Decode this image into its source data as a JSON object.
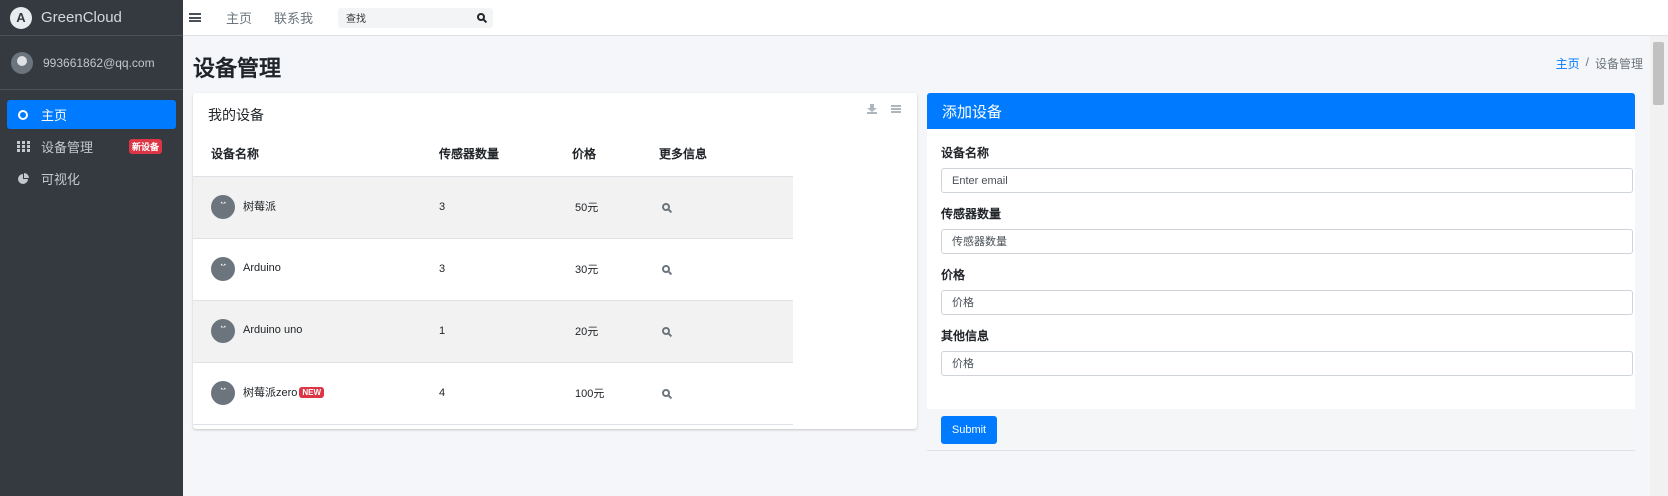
{
  "brand": {
    "name": "GreenCloud",
    "logo_letter": "A"
  },
  "user": {
    "email": "993661862@qq.com"
  },
  "sidebar": {
    "items": [
      {
        "label": "主页",
        "icon": "circle-icon",
        "active": true
      },
      {
        "label": "设备管理",
        "icon": "grid-icon",
        "badge": "新设备"
      },
      {
        "label": "可视化",
        "icon": "pie-chart-icon"
      }
    ]
  },
  "topbar": {
    "links": [
      "主页",
      "联系我"
    ],
    "search": {
      "value": "查找"
    }
  },
  "page": {
    "title": "设备管理",
    "breadcrumb": {
      "home": "主页",
      "separator": "/",
      "current": "设备管理"
    }
  },
  "devices_card": {
    "title": "我的设备",
    "columns": [
      "设备名称",
      "传感器数量",
      "价格",
      "更多信息"
    ],
    "rows": [
      {
        "name": "树莓派",
        "sensors": "3",
        "price": "50元"
      },
      {
        "name": "Arduino",
        "sensors": "3",
        "price": "30元"
      },
      {
        "name": "Arduino uno",
        "sensors": "1",
        "price": "20元"
      },
      {
        "name": "树莓派zero",
        "sensors": "4",
        "price": "100元",
        "tag": "NEW"
      }
    ]
  },
  "add_card": {
    "title": "添加设备",
    "fields": [
      {
        "label": "设备名称",
        "placeholder": "Enter email"
      },
      {
        "label": "传感器数量",
        "placeholder": "传感器数量"
      },
      {
        "label": "价格",
        "placeholder": "价格"
      },
      {
        "label": "其他信息",
        "placeholder": "价格"
      }
    ],
    "submit_label": "Submit"
  },
  "colors": {
    "primary": "#007bff",
    "sidebar": "#343a40",
    "danger": "#dc3545"
  }
}
